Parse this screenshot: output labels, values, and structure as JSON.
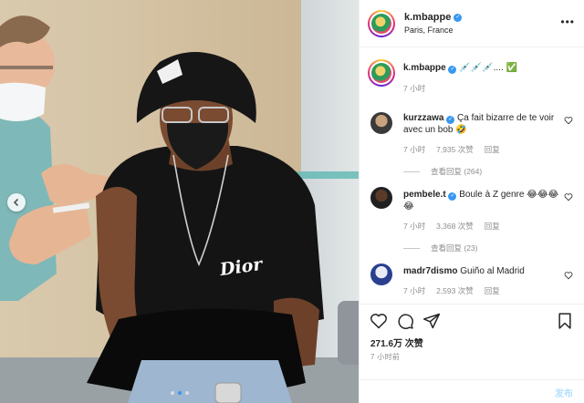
{
  "post": {
    "username": "k.mbappe",
    "location": "Paris, France",
    "caption_emojis": "💉💉💉.... ✅",
    "caption_time": "7 小时"
  },
  "photo": {
    "shirt_logo": "DIOR"
  },
  "comments": [
    {
      "username": "kurzzawa",
      "verified": true,
      "text": "Ça fait bizarre de te voir avec un bob 🤣",
      "time": "7 小时",
      "likes": "7,935 次赞",
      "reply_label": "回复",
      "view_replies": "查看回复 (264)"
    },
    {
      "username": "pembele.t",
      "verified": true,
      "text": "Boule à Z genre 😂😂😂😂",
      "time": "7 小时",
      "likes": "3,368 次赞",
      "reply_label": "回复",
      "view_replies": "查看回复 (23)"
    },
    {
      "username": "madr7dismo",
      "verified": false,
      "text": "Guiño al Madrid",
      "time": "7 小时",
      "likes": "2,593 次赞",
      "reply_label": "回复"
    }
  ],
  "engagement": {
    "likes": "271.6万 次赞",
    "time": "7 小时前"
  },
  "add_comment": {
    "placeholder": "",
    "post_label": "发布"
  },
  "icons": {
    "like": "heart-icon",
    "comment": "comment-icon",
    "share": "paper-plane-icon",
    "save": "bookmark-icon",
    "prev": "chevron-left-icon",
    "more": "more-icon"
  },
  "colors": {
    "verified": "#3897f0",
    "post_button": "#b2dffc",
    "muted_text": "#8e8e8e"
  },
  "carousel": {
    "total": 3,
    "active": 1
  }
}
